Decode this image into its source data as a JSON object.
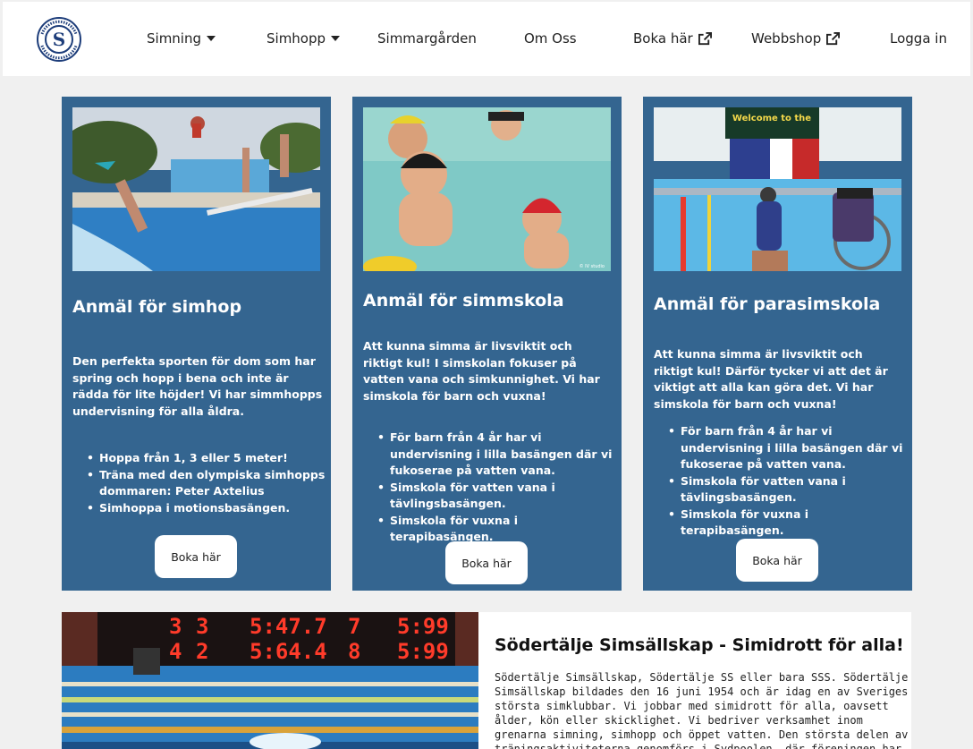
{
  "header": {
    "logo_alt": "Södertälje Simsällskap",
    "nav": {
      "simning": "Simning",
      "simhopp": "Simhopp",
      "simmargarden": "Simmargården",
      "om_oss": "Om Oss",
      "boka_har": "Boka här",
      "webbshop": "Webbshop",
      "logga_in": "Logga in"
    }
  },
  "cards": [
    {
      "title": "Anmäl för simhop",
      "description": "Den perfekta sporten för dom som har spring och hopp i bena och inte är rädda för lite höjder! Vi har simmhopps undervisning för alla åldra.",
      "bullets": [
        "Hoppa från 1, 3 eller 5 meter!",
        "Träna med den olympiska simhopps dommaren: Peter Axtelius",
        "Simhoppa i motionsbasängen."
      ],
      "button": "Boka här"
    },
    {
      "title": "Anmäl för simmskola",
      "description": "Att kunna simma är livsviktit och riktigt kul! I simskolan fokuser på vatten vana och simkunnighet. Vi har simskola för barn och vuxna!",
      "bullets": [
        "För barn från 4 år har vi undervisning i lilla basängen där vi fukoserae på vatten vana.",
        "Simskola för vatten vana i tävlingsbasängen.",
        "Simskola för vuxna i terapibasängen."
      ],
      "button": "Boka här",
      "image_credit": "© IV studio"
    },
    {
      "title": "Anmäl för parasimskola",
      "description": "Att kunna simma är livsviktit och riktigt kul! Därför tycker vi att det är viktigt att alla kan göra det. Vi har simskola för barn och vuxna!",
      "bullets": [
        "För barn från 4 år har vi undervisning i lilla basängen där vi fukoserae på vatten vana.",
        "Simskola för vatten vana i tävlingsbasängen.",
        "Simskola för vuxna i terapibasängen."
      ],
      "button": "Boka här",
      "image_sign": "Welcome to the"
    }
  ],
  "scoreboard": {
    "row1": [
      "3",
      "3",
      "5:47.7",
      "7",
      "5:99"
    ],
    "row2": [
      "4",
      "2",
      "5:64.4",
      "8",
      "5:99"
    ]
  },
  "about": {
    "title": "Södertälje Simsällskap - Simidrott för alla!",
    "text": "Södertälje Simsällskap, Södertälje SS eller bara SSS. Södertälje Simsällskap bildades den 16 juni 1954 och är idag en av Sveriges största simklubbar. Vi jobbar med simidrott för alla, oavsett ålder, kön eller skicklighet. Vi bedriver verksamhet inom grenarna simning, simhopp och öppet vatten. Den största delen av träningsaktiviteterna genomförs i Sydpoolen, där föreningen har sitt kansli. Södertälje Simsällskap..."
  },
  "colors": {
    "card_bg": "#346590",
    "page_bg": "#f0f0f0",
    "header_bg": "#ffffff"
  }
}
